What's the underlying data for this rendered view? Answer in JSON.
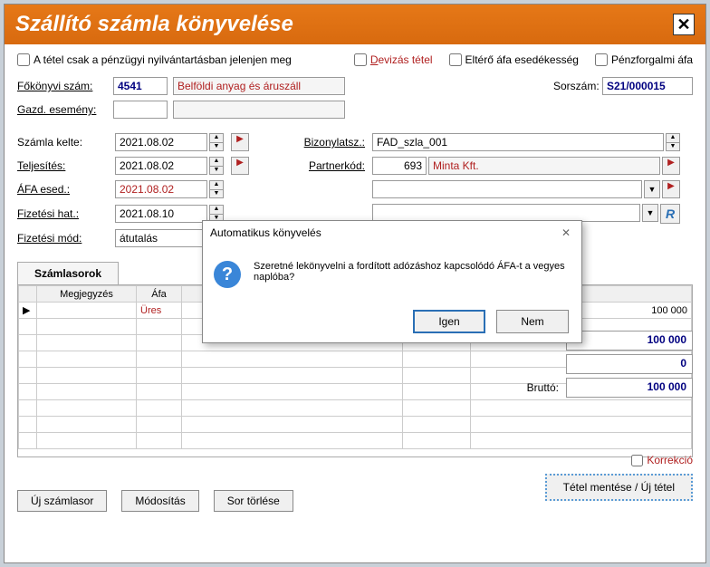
{
  "window": {
    "title": "Szállító számla könyvelése"
  },
  "checks": {
    "only_finance": "A tétel csak a pénzügyi nyilvántartásban jelenjen meg",
    "devizas": "Devizás tétel",
    "eltero_afa": "Eltérő áfa esedékesség",
    "penzforgalmi": "Pénzforgalmi áfa"
  },
  "fields": {
    "fokonvyi_label": "Főkönyvi szám:",
    "fokonvyi_value": "4541",
    "fokonvyi_desc": "Belföldi anyag és áruszáll",
    "gazd_label": "Gazd. esemény:",
    "gazd_value": "",
    "sorszam_label": "Sorszám:",
    "sorszam_value": "S21/000015",
    "szamla_kelte_label": "Számla kelte:",
    "szamla_kelte_value": "2021.08.02",
    "teljesites_label": "Teljesítés:",
    "teljesites_value": "2021.08.02",
    "afa_esed_label": "ÁFA esed.:",
    "afa_esed_value": "2021.08.02",
    "fizetesi_hat_label": "Fizetési hat.:",
    "fizetesi_hat_value": "2021.08.10",
    "fizetesi_mod_label": "Fizetési mód:",
    "fizetesi_mod_value": "átutalás",
    "bizonylatsz_label": "Bizonylatsz.:",
    "bizonylatsz_value": "FAD_szla_001",
    "partnerkod_label": "Partnerkód:",
    "partnerkod_value": "693",
    "partner_name": "Minta Kft."
  },
  "tabs": {
    "tab1": "Számlasorok"
  },
  "grid": {
    "col_megj": "Megjegyzés",
    "col_afa": "Áfa",
    "row1_afa": "Üres",
    "row1_val1": "100 000",
    "row1_val2": "0",
    "row1_val3": "100 000"
  },
  "totals": {
    "netto_label": "",
    "netto_value": "100 000",
    "afa_value": "0",
    "brutto_label": "Bruttó:",
    "brutto_value": "100 000"
  },
  "korrekcio": "Korrekció",
  "buttons": {
    "uj_sor": "Új számlasor",
    "modositas": "Módosítás",
    "sor_torlese": "Sor törlése",
    "save": "Tétel mentése / Új tétel"
  },
  "dialog": {
    "title": "Automatikus könyvelés",
    "message": "Szeretné lekönyvelni a fordított adózáshoz kapcsolódó ÁFA-t a vegyes naplóba?",
    "yes": "Igen",
    "no": "Nem"
  }
}
